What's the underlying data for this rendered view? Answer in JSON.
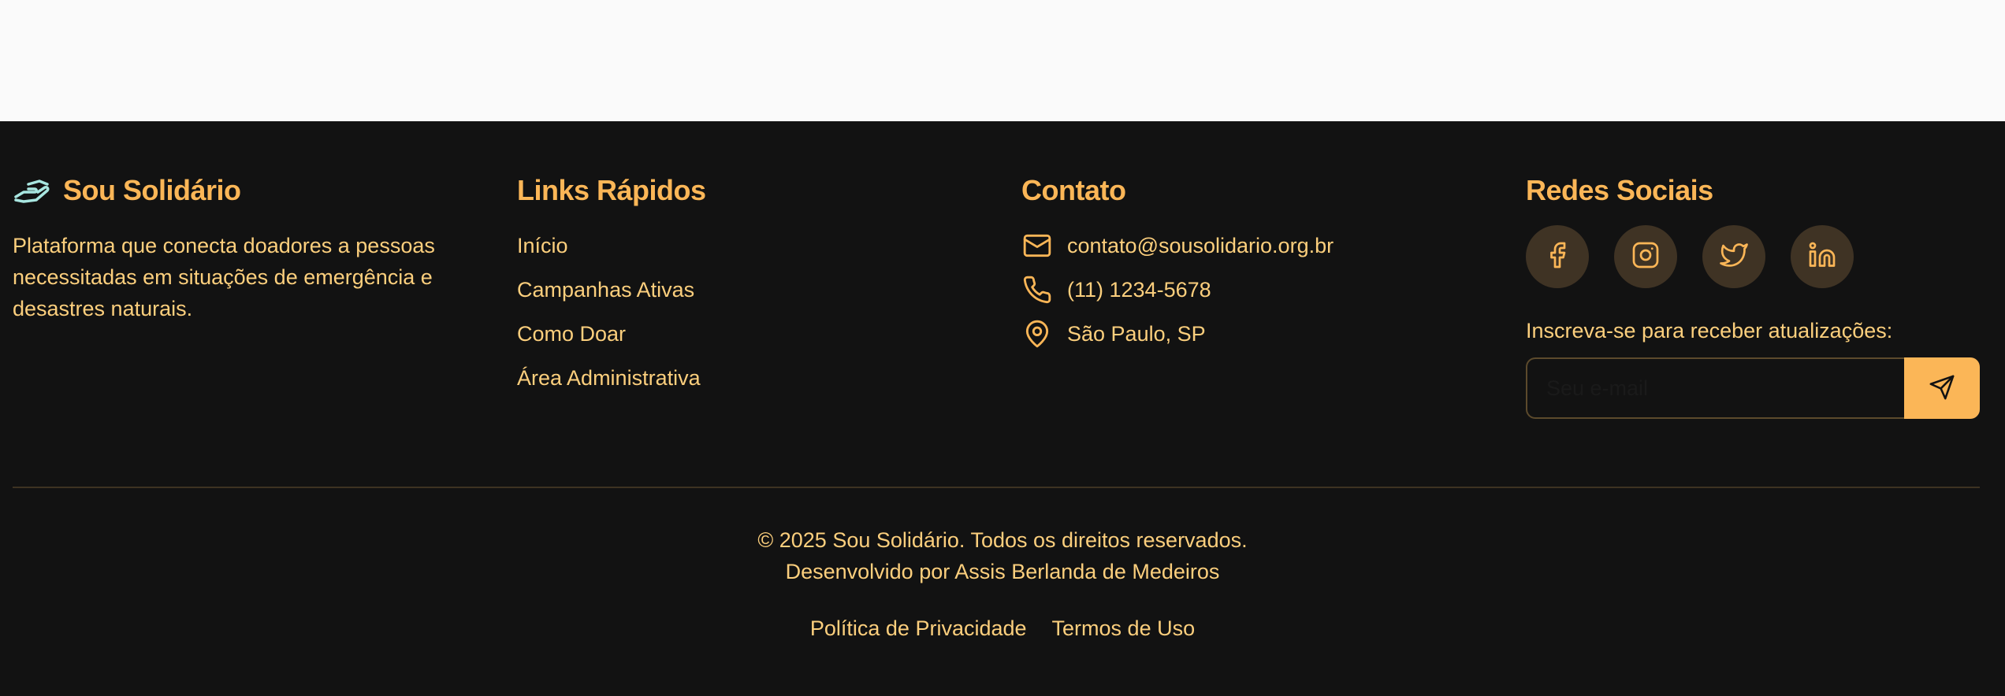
{
  "colors": {
    "footer_bg": "#121212",
    "heading": "#fbb657",
    "text": "#fccf7d",
    "social_bg": "#3f3324",
    "brand_icon": "#a8e6e0"
  },
  "brand": {
    "name": "Sou Solidário",
    "icon": "handshake-icon",
    "description": "Plataforma que conecta doadores a pessoas necessitadas em situações de emergência e desastres naturais."
  },
  "quick_links": {
    "title": "Links Rápidos",
    "items": [
      {
        "label": "Início"
      },
      {
        "label": "Campanhas Ativas"
      },
      {
        "label": "Como Doar"
      },
      {
        "label": "Área Administrativa"
      }
    ]
  },
  "contact": {
    "title": "Contato",
    "email": "contato@sousolidario.org.br",
    "phone": "(11) 1234-5678",
    "location": "São Paulo, SP"
  },
  "social": {
    "title": "Redes Sociais",
    "icons": [
      "facebook-icon",
      "instagram-icon",
      "twitter-icon",
      "linkedin-icon"
    ],
    "subscribe_label": "Inscreva-se para receber atualizações:",
    "email_placeholder": "Seu e-mail"
  },
  "bottom": {
    "copyright": "© 2025 Sou Solidário. Todos os direitos reservados.",
    "developer": "Desenvolvido por Assis Berlanda de Medeiros",
    "privacy": "Política de Privacidade",
    "terms": "Termos de Uso"
  }
}
